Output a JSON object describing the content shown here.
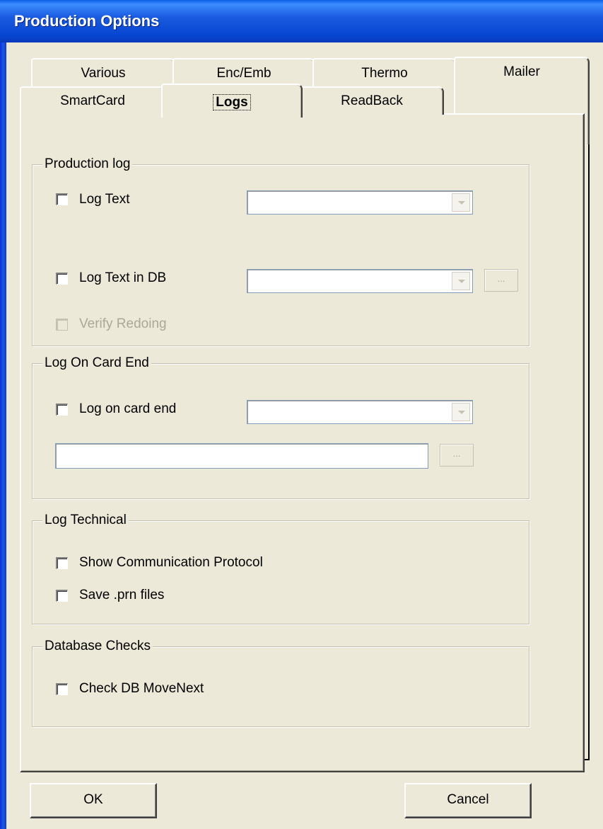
{
  "window": {
    "title": "Production Options"
  },
  "tabs": {
    "row_back": [
      "Various",
      "Enc/Emb",
      "Thermo",
      "Mailer"
    ],
    "row_front": [
      "SmartCard",
      "Logs",
      "ReadBack"
    ],
    "active": "Logs"
  },
  "production_log": {
    "legend": "Production log",
    "log_text_label": "Log Text",
    "log_text_in_db_label": "Log Text in DB",
    "verify_redoing_label": "Verify Redoing",
    "browse_label": "..."
  },
  "log_on_card_end": {
    "legend": "Log On Card End",
    "log_on_card_end_label": "Log on card end",
    "browse_label": "..."
  },
  "log_technical": {
    "legend": "Log Technical",
    "show_protocol_label": "Show Communication Protocol",
    "save_prn_label": "Save .prn files"
  },
  "database_checks": {
    "legend": "Database Checks",
    "check_movenext_label": "Check DB MoveNext"
  },
  "buttons": {
    "ok": "OK",
    "cancel": "Cancel"
  }
}
